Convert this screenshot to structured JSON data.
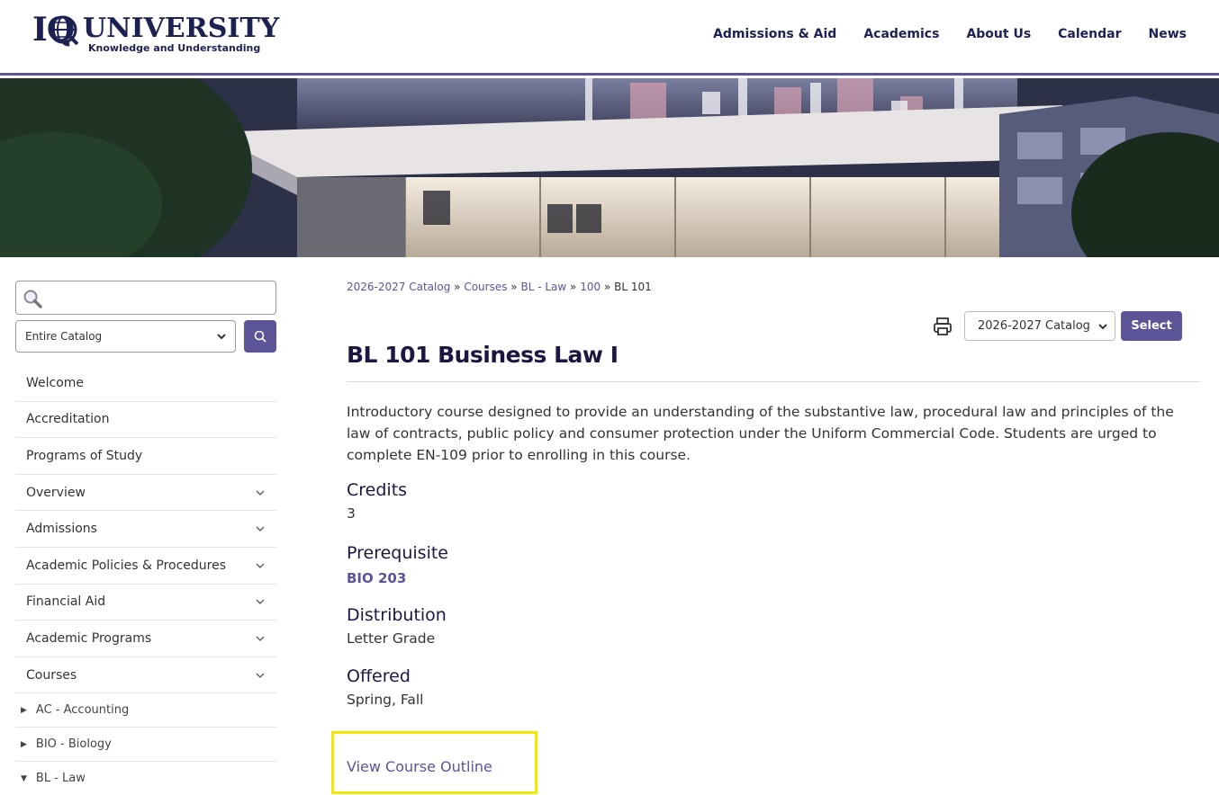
{
  "header": {
    "logo_iq": "IQ",
    "logo_name": "UNIVERSITY",
    "logo_tagline": "Knowledge and Understanding",
    "nav": [
      "Admissions & Aid",
      "Academics",
      "About Us",
      "Calendar",
      "News"
    ]
  },
  "sidebar": {
    "search_value": "",
    "scope_select": "Entire Catalog",
    "menu": [
      {
        "label": "Welcome",
        "expandable": false
      },
      {
        "label": "Accreditation",
        "expandable": false
      },
      {
        "label": "Programs of Study",
        "expandable": false
      },
      {
        "label": "Overview",
        "expandable": true
      },
      {
        "label": "Admissions",
        "expandable": true
      },
      {
        "label": "Academic Policies & Procedures",
        "expandable": true
      },
      {
        "label": "Financial Aid",
        "expandable": true
      },
      {
        "label": "Academic Programs",
        "expandable": true
      },
      {
        "label": "Courses",
        "expandable": true
      }
    ],
    "sub_items": [
      {
        "label": "AC - Accounting",
        "marker": "▶"
      },
      {
        "label": "BIO - Biology",
        "marker": "▶"
      },
      {
        "label": "BL - Law",
        "marker": "▼"
      }
    ]
  },
  "breadcrumb": {
    "items": [
      "2026-2027 Catalog",
      "Courses",
      "BL - Law",
      "100"
    ],
    "current": "BL 101",
    "separator": "»"
  },
  "catalog_select": {
    "value": "2026-2027 Catalog",
    "button": "Select"
  },
  "course": {
    "title": "BL 101 Business Law I",
    "description": "Introductory course designed to provide an understanding of the substantive law, procedural law and principles of the law of contracts, public policy and consumer protection under the Uniform Commercial Code. Students are urged to complete EN-109 prior to enrolling in this course.",
    "credits_label": "Credits",
    "credits_value": "3",
    "prereq_label": "Prerequisite",
    "prereq_value": "BIO 203",
    "distribution_label": "Distribution",
    "distribution_value": "Letter Grade",
    "offered_label": "Offered",
    "offered_value": "Spring, Fall",
    "outline_link": "View Course Outline"
  },
  "colors": {
    "brand": "#5b5497",
    "navy": "#1d2152",
    "highlight": "#f2e800"
  }
}
